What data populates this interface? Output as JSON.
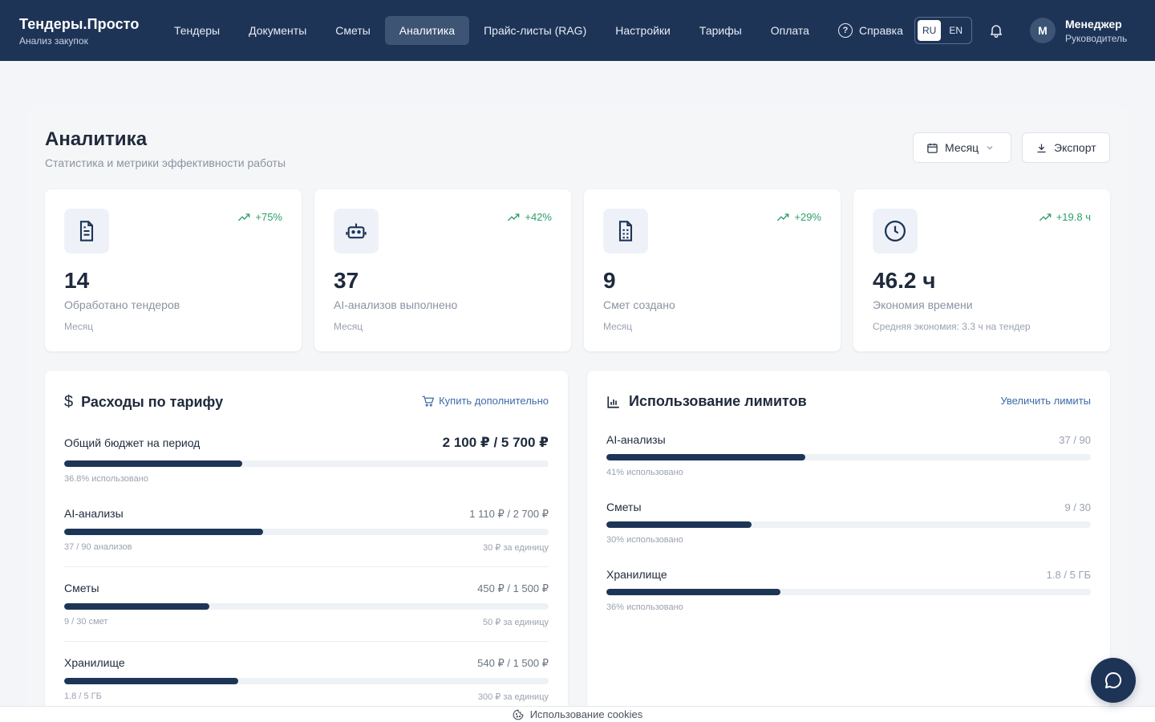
{
  "brand": {
    "title": "Тендеры.Просто",
    "subtitle": "Анализ закупок"
  },
  "nav": {
    "items": [
      {
        "label": "Тендеры"
      },
      {
        "label": "Документы"
      },
      {
        "label": "Сметы"
      },
      {
        "label": "Аналитика",
        "active": true
      },
      {
        "label": "Прайс-листы (RAG)"
      },
      {
        "label": "Настройки"
      },
      {
        "label": "Тарифы"
      },
      {
        "label": "Оплата"
      }
    ],
    "help_label": "Справка",
    "lang": {
      "ru": "RU",
      "en": "EN",
      "active": "RU"
    }
  },
  "user": {
    "initial": "M",
    "name": "Менеджер",
    "role": "Руководитель"
  },
  "page": {
    "title": "Аналитика",
    "subtitle": "Статистика и метрики эффективности работы",
    "period_button": "Месяц",
    "export_button": "Экспорт"
  },
  "stats": [
    {
      "icon": "document-icon",
      "trend": "+75%",
      "value": "14",
      "label": "Обработано тендеров",
      "period": "Месяц"
    },
    {
      "icon": "robot-icon",
      "trend": "+42%",
      "value": "37",
      "label": "AI-анализов выполнено",
      "period": "Месяц"
    },
    {
      "icon": "spreadsheet-icon",
      "trend": "+29%",
      "value": "9",
      "label": "Смет создано",
      "period": "Месяц"
    },
    {
      "icon": "clock-icon",
      "trend": "+19.8 ч",
      "value": "46.2 ч",
      "label": "Экономия времени",
      "period": "Средняя экономия: 3.3 ч на тендер"
    }
  ],
  "expenses": {
    "title": "Расходы по тарифу",
    "link": "Купить дополнительно",
    "budget": {
      "name": "Общий бюджет на период",
      "value": "2 100 ₽ / 5 700 ₽",
      "percent_text": "36.8% использовано",
      "fraction": 0.368
    },
    "items": [
      {
        "name": "AI-анализы",
        "value": "1 110 ₽ / 2 700 ₽",
        "left": "37 / 90 анализов",
        "right": "30 ₽ за единицу",
        "fraction": 0.411
      },
      {
        "name": "Сметы",
        "value": "450 ₽ / 1 500 ₽",
        "left": "9 / 30 смет",
        "right": "50 ₽ за единицу",
        "fraction": 0.3
      },
      {
        "name": "Хранилище",
        "value": "540 ₽ / 1 500 ₽",
        "left": "1.8 / 5 ГБ",
        "right": "300 ₽ за единицу",
        "fraction": 0.36
      }
    ]
  },
  "limits": {
    "title": "Использование лимитов",
    "link": "Увеличить лимиты",
    "items": [
      {
        "name": "AI-анализы",
        "value": "37 / 90",
        "used": "41% использовано",
        "fraction": 0.41
      },
      {
        "name": "Сметы",
        "value": "9 / 30",
        "used": "30% использовано",
        "fraction": 0.3
      },
      {
        "name": "Хранилище",
        "value": "1.8 / 5 ГБ",
        "used": "36% использовано",
        "fraction": 0.36
      }
    ]
  },
  "cookies": {
    "label": "Использование cookies"
  },
  "colors": {
    "navy": "#1e3457",
    "bar": "#1d3557",
    "trend": "#2e9e6a",
    "link": "#3d6aa8"
  }
}
